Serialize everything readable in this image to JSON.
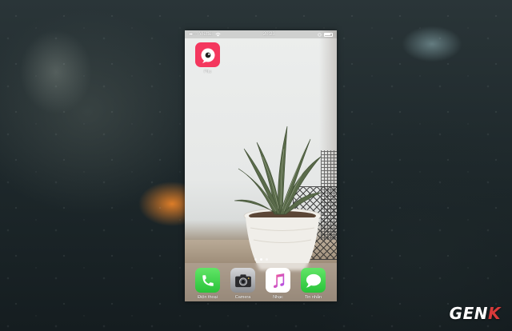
{
  "status_bar": {
    "carrier": "Viettel",
    "time": "20:23"
  },
  "home_apps": [
    {
      "label": "Pitu",
      "icon": "pitu-icon",
      "color": "#f4375e"
    }
  ],
  "page_indicator": {
    "pages": 3,
    "current": 2
  },
  "dock": [
    {
      "label": "Điện thoại",
      "icon": "phone-icon"
    },
    {
      "label": "Camera",
      "icon": "camera-icon"
    },
    {
      "label": "Nhạc",
      "icon": "music-icon"
    },
    {
      "label": "Tin nhắn",
      "icon": "messages-icon"
    }
  ],
  "watermark": {
    "text_main": "GEN",
    "text_accent": "K",
    "accent_color": "#d93a3a"
  }
}
